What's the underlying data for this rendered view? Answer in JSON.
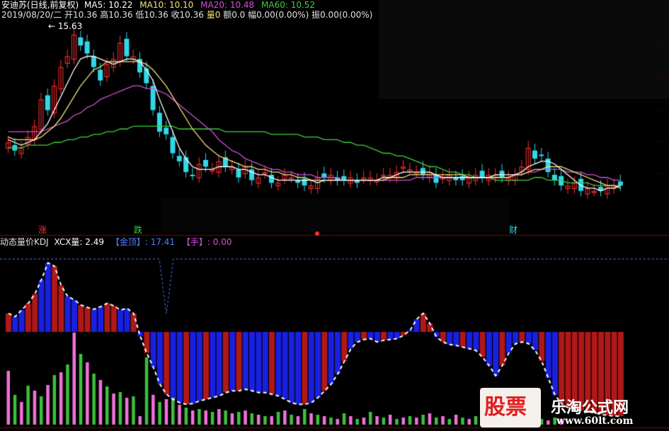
{
  "header": {
    "title": "安迪苏(日线,前复权)",
    "ma": [
      {
        "label": "MA5: 10.22",
        "color": "#ffffff"
      },
      {
        "label": "MA10: 10.10",
        "color": "#f2e27a"
      },
      {
        "label": "MA20: 10.48",
        "color": "#d64fd6"
      },
      {
        "label": "MA60: 10.52",
        "color": "#3fcf3f"
      }
    ],
    "line2": "2019/08/20/二 开10.36 高10.36 低10.36 收10.36",
    "vol_label": "量0",
    "line2_tail": "额0.0 幅0.00(0.00%) 振0.00(0.00%)"
  },
  "indicator": {
    "name": "动态量价KDJ",
    "items": [
      {
        "label": "XCX量: 2.49",
        "color": "#ffffff"
      },
      {
        "label": "【金顶】: 17.41",
        "color": "#4f7cff"
      },
      {
        "label": "【手】: 0.00",
        "color": "#d64fd6"
      }
    ]
  },
  "markers": {
    "zhang": "涨",
    "die": "跌",
    "cai": "财"
  },
  "watermark": {
    "left": "股票",
    "title": "乐淘公式网",
    "url": "www.60lt.com"
  },
  "colors": {
    "up": "#ff3030",
    "down": "#30d8e8",
    "ma5": "#ffffff",
    "ma10": "#f2e27a",
    "ma20": "#d64fd6",
    "ma60": "#3fcf3f",
    "red_bar": "#b01818",
    "blue_bar": "#1a20e0",
    "pink_bar": "#f070d8",
    "green_bar": "#3cbf3c"
  },
  "chart_data": {
    "type": "candlestick",
    "max_label": "15.63",
    "close": [
      11.4,
      11.1,
      11.2,
      11.6,
      12.0,
      13.0,
      12.6,
      13.5,
      14.2,
      14.6,
      15.4,
      15.0,
      14.7,
      14.2,
      13.7,
      14.3,
      14.5,
      15.1,
      14.6,
      14.6,
      14.0,
      13.6,
      12.6,
      11.8,
      11.7,
      11.0,
      10.7,
      10.3,
      10.2,
      10.6,
      10.5,
      10.4,
      10.7,
      10.5,
      10.5,
      10.1,
      10.5,
      10.0,
      10.1,
      10.3,
      9.9,
      9.9,
      10.2,
      10.1,
      9.9,
      9.8,
      9.8,
      10.1,
      10.1,
      10.2,
      10.0,
      10.0,
      10.1,
      9.9,
      10.1,
      10.1,
      10.0,
      10.2,
      10.2,
      10.3,
      10.5,
      10.4,
      10.3,
      10.2,
      10.3,
      9.9,
      10.1,
      10.2,
      10.0,
      10.0,
      10.1,
      10.2,
      10.1,
      10.2,
      10.2,
      10.1,
      10.1,
      10.2,
      10.5,
      11.2,
      10.8,
      10.9,
      10.3,
      10.0,
      9.8,
      9.8,
      9.9,
      9.6,
      9.7,
      9.6,
      9.6,
      9.8,
      9.8,
      9.8
    ],
    "ma5": [
      11.5,
      11.4,
      11.3,
      11.4,
      11.5,
      11.8,
      12.1,
      12.6,
      13.1,
      13.6,
      14.1,
      14.5,
      14.6,
      14.6,
      14.5,
      14.4,
      14.3,
      14.4,
      14.5,
      14.5,
      14.4,
      14.1,
      13.7,
      13.0,
      12.4,
      11.8,
      11.2,
      10.8,
      10.5,
      10.4,
      10.4,
      10.4,
      10.5,
      10.5,
      10.5,
      10.4,
      10.4,
      10.3,
      10.2,
      10.2,
      10.1,
      10.0,
      10.0,
      10.0,
      10.0,
      10.0,
      10.0,
      9.9,
      10.0,
      10.0,
      10.0,
      10.0,
      10.0,
      10.0,
      10.0,
      10.0,
      10.0,
      10.1,
      10.1,
      10.2,
      10.3,
      10.3,
      10.3,
      10.3,
      10.3,
      10.2,
      10.1,
      10.1,
      10.1,
      10.1,
      10.1,
      10.1,
      10.1,
      10.1,
      10.2,
      10.2,
      10.2,
      10.2,
      10.3,
      10.5,
      10.6,
      10.7,
      10.7,
      10.6,
      10.4,
      10.2,
      10.0,
      9.8,
      9.7,
      9.7,
      9.6,
      9.7,
      9.7,
      9.8
    ],
    "ma10": [
      11.6,
      11.5,
      11.5,
      11.5,
      11.5,
      11.6,
      11.8,
      12.0,
      12.3,
      12.7,
      13.1,
      13.5,
      13.8,
      14.1,
      14.2,
      14.4,
      14.4,
      14.4,
      14.4,
      14.4,
      14.4,
      14.3,
      14.1,
      13.8,
      13.5,
      13.1,
      12.7,
      12.3,
      11.9,
      11.6,
      11.3,
      11.1,
      10.9,
      10.8,
      10.7,
      10.6,
      10.5,
      10.5,
      10.4,
      10.4,
      10.3,
      10.3,
      10.2,
      10.2,
      10.1,
      10.1,
      10.0,
      10.0,
      10.0,
      10.0,
      10.0,
      10.0,
      10.0,
      10.0,
      10.0,
      10.0,
      10.0,
      10.0,
      10.1,
      10.1,
      10.1,
      10.2,
      10.2,
      10.2,
      10.2,
      10.2,
      10.2,
      10.2,
      10.2,
      10.2,
      10.1,
      10.1,
      10.1,
      10.1,
      10.1,
      10.1,
      10.1,
      10.2,
      10.2,
      10.3,
      10.4,
      10.4,
      10.5,
      10.5,
      10.5,
      10.4,
      10.3,
      10.2,
      10.1,
      10.0,
      9.9,
      9.8,
      9.8,
      9.7
    ],
    "ma20": [
      11.8,
      11.8,
      11.8,
      11.8,
      11.8,
      11.8,
      11.9,
      12.0,
      12.1,
      12.2,
      12.4,
      12.5,
      12.7,
      12.8,
      13.0,
      13.1,
      13.2,
      13.3,
      13.4,
      13.5,
      13.5,
      13.4,
      13.4,
      13.3,
      13.2,
      13.0,
      12.8,
      12.6,
      12.4,
      12.2,
      12.0,
      11.8,
      11.5,
      11.3,
      11.1,
      11.0,
      10.8,
      10.7,
      10.6,
      10.5,
      10.4,
      10.4,
      10.3,
      10.3,
      10.2,
      10.2,
      10.2,
      10.1,
      10.1,
      10.1,
      10.1,
      10.0,
      10.0,
      10.0,
      10.0,
      10.0,
      10.0,
      10.0,
      10.0,
      10.0,
      10.0,
      10.0,
      10.1,
      10.1,
      10.1,
      10.1,
      10.1,
      10.1,
      10.1,
      10.1,
      10.1,
      10.1,
      10.1,
      10.1,
      10.1,
      10.1,
      10.1,
      10.2,
      10.2,
      10.3,
      10.3,
      10.4,
      10.4,
      10.4,
      10.4,
      10.3,
      10.3,
      10.3,
      10.2,
      10.2,
      10.1,
      10.1,
      10.0,
      10.0
    ],
    "ma60": [
      11.2,
      11.2,
      11.2,
      11.3,
      11.3,
      11.3,
      11.3,
      11.4,
      11.4,
      11.5,
      11.5,
      11.6,
      11.6,
      11.7,
      11.7,
      11.8,
      11.8,
      11.9,
      11.9,
      12.0,
      12.0,
      12.0,
      12.0,
      12.0,
      12.0,
      12.0,
      11.9,
      11.9,
      11.9,
      11.9,
      11.9,
      11.9,
      11.9,
      11.8,
      11.8,
      11.8,
      11.8,
      11.8,
      11.8,
      11.8,
      11.7,
      11.7,
      11.7,
      11.7,
      11.7,
      11.6,
      11.6,
      11.6,
      11.5,
      11.5,
      11.5,
      11.4,
      11.4,
      11.3,
      11.3,
      11.2,
      11.1,
      11.0,
      11.0,
      10.9,
      10.9,
      10.8,
      10.7,
      10.6,
      10.5,
      10.5,
      10.4,
      10.3,
      10.3,
      10.2,
      10.2,
      10.1,
      10.1,
      10.1,
      10.0,
      10.0,
      10.0,
      10.0,
      10.0,
      10.0,
      10.1,
      10.1,
      10.0,
      10.0,
      10.0,
      9.9,
      9.9,
      9.9,
      9.9,
      9.8,
      9.8,
      9.8,
      9.8,
      9.8
    ],
    "kdj_line": [
      22,
      18,
      26,
      34,
      45,
      62,
      82,
      78,
      55,
      42,
      38,
      32,
      29,
      27,
      30,
      34,
      31,
      26,
      28,
      22,
      -5,
      -25,
      -42,
      -62,
      -74,
      -80,
      -84,
      -86,
      -85,
      -82,
      -80,
      -78,
      -76,
      -72,
      -70,
      -70,
      -68,
      -70,
      -72,
      -72,
      -74,
      -76,
      -80,
      -84,
      -86,
      -86,
      -84,
      -78,
      -70,
      -62,
      -50,
      -35,
      -20,
      -12,
      -9,
      -8,
      -12,
      -10,
      -9,
      -8,
      -4,
      2,
      15,
      22,
      10,
      -6,
      -12,
      -15,
      -16,
      -18,
      -20,
      -22,
      -30,
      -40,
      -52,
      -40,
      -25,
      -14,
      -12,
      -14,
      -22,
      -35,
      -55,
      -75,
      -85,
      -90,
      -92,
      -93,
      -95,
      -96,
      -98,
      -99,
      -100,
      -100
    ],
    "kdj_top": 17.41,
    "vol_bars": [
      76,
      42,
      32,
      55,
      48,
      40,
      56,
      70,
      74,
      85,
      130,
      100,
      88,
      72,
      63,
      54,
      44,
      46,
      38,
      40,
      12,
      95,
      42,
      32,
      36,
      38,
      28,
      24,
      20,
      22,
      20,
      18,
      22,
      20,
      16,
      18,
      20,
      16,
      14,
      12,
      12,
      18,
      20,
      14,
      12,
      22,
      16,
      14,
      12,
      10,
      8,
      16,
      12,
      8,
      10,
      18,
      12,
      10,
      14,
      8,
      10,
      12,
      10,
      14,
      16,
      10,
      12,
      8,
      14,
      10,
      8,
      12,
      10,
      16,
      14,
      12,
      10,
      8,
      12,
      18,
      10,
      8,
      6,
      10,
      8,
      6,
      5,
      4,
      4,
      5,
      4,
      3,
      3,
      2
    ]
  }
}
